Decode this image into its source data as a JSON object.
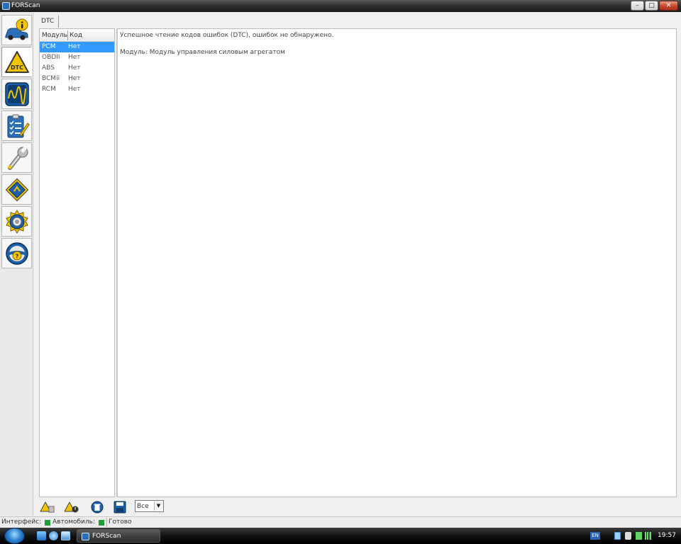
{
  "window": {
    "title": "FORScan",
    "minimize": "–",
    "maximize": "□",
    "close": "✕"
  },
  "tools": [
    {
      "name": "vehicle-info",
      "icon": "car-info-icon"
    },
    {
      "name": "dtc",
      "icon": "dtc-warning-icon",
      "label": "DTC"
    },
    {
      "name": "oscilloscope",
      "icon": "oscilloscope-icon"
    },
    {
      "name": "tests",
      "icon": "checklist-icon"
    },
    {
      "name": "service",
      "icon": "wrench-icon"
    },
    {
      "name": "configuration",
      "icon": "chip-icon"
    },
    {
      "name": "settings",
      "icon": "gear-icon"
    },
    {
      "name": "help",
      "icon": "steering-wheel-help-icon",
      "label": "?"
    }
  ],
  "tab": {
    "label": "DTC"
  },
  "module_table": {
    "columns": [
      "Модуль",
      "Код"
    ],
    "rows": [
      {
        "module": "PCM",
        "code": "Нет",
        "selected": true
      },
      {
        "module": "OBDII",
        "code": "Нет",
        "selected": false
      },
      {
        "module": "ABS",
        "code": "Нет",
        "selected": false
      },
      {
        "module": "BCMii",
        "code": "Нет",
        "selected": false
      },
      {
        "module": "RCM",
        "code": "Нет",
        "selected": false
      }
    ]
  },
  "info": {
    "line1": "Успешное чтение кодов ошибок (DTC), ошибок не обнаружено.",
    "line2": "Модуль: Модуль управления силовым агрегатом"
  },
  "bottom_toolbar": {
    "buttons": [
      "read-dtc-icon",
      "clear-dtc-icon",
      "delete-icon",
      "save-icon"
    ],
    "filter_value": "Все",
    "filter_arrow": "▼"
  },
  "status": {
    "interface_label": "Интерфейс:",
    "vehicle_label": "Автомобиль:",
    "state": "Готово",
    "ok_color": "#1f9e3a"
  },
  "taskbar": {
    "task_label": "FORScan",
    "language": "EN",
    "time": "19:57"
  }
}
